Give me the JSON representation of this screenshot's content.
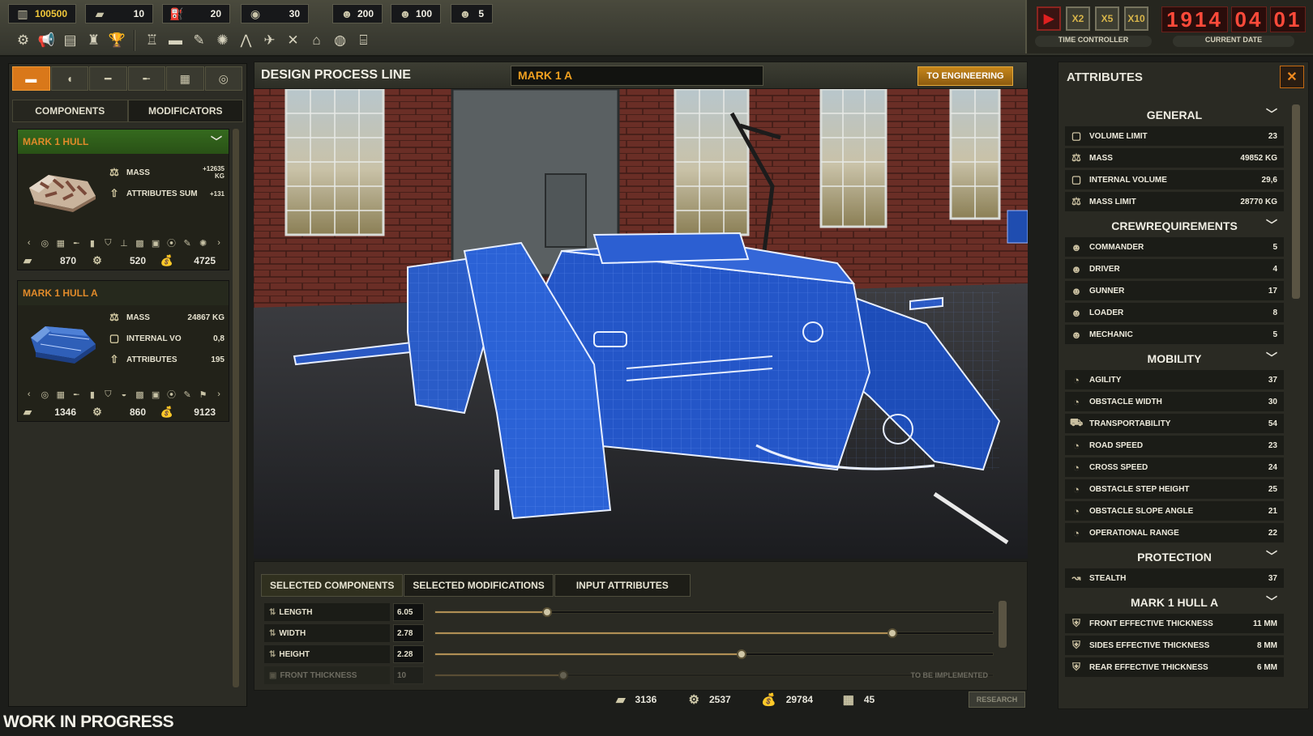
{
  "resources": [
    {
      "icon": "gold-icon",
      "value": "100500",
      "gold": true
    },
    {
      "icon": "steel-icon",
      "value": "10"
    },
    {
      "icon": "fuel-icon",
      "value": "20"
    },
    {
      "icon": "rubber-icon",
      "value": "30"
    },
    {
      "icon": "engineer-icon",
      "value": "200"
    },
    {
      "icon": "worker-icon",
      "value": "100"
    },
    {
      "icon": "officer-icon",
      "value": "5"
    }
  ],
  "time_controller": {
    "play": "▶",
    "x2": "X2",
    "x5": "X5",
    "x10": "X10",
    "caption": "TIME CONTROLLER"
  },
  "current_date": {
    "year": "1914",
    "month": "04",
    "day": "01",
    "caption": "CURRENT DATE"
  },
  "left_panel": {
    "subtabs": [
      "COMPONENTS",
      "MODIFICATORS"
    ],
    "components": [
      {
        "name": "MARK 1 HULL",
        "stats": [
          {
            "icon": "mass-icon",
            "label": "MASS",
            "value": "+12635 KG"
          },
          {
            "icon": "attributes-icon",
            "label": "ATTRIBUTES SUM",
            "value": "+131"
          }
        ],
        "costs": [
          {
            "icon": "steel-icon",
            "value": "870"
          },
          {
            "icon": "gear-icon",
            "value": "520"
          },
          {
            "icon": "money-bag-icon",
            "value": "4725"
          }
        ]
      },
      {
        "name": "MARK 1 HULL A",
        "stats": [
          {
            "icon": "mass-icon",
            "label": "MASS",
            "value": "24867 KG"
          },
          {
            "icon": "volume-icon",
            "label": "INTERNAL VO",
            "value": "0,8"
          },
          {
            "icon": "attributes-icon",
            "label": "ATTRIBUTES",
            "value": "195"
          }
        ],
        "costs": [
          {
            "icon": "steel-icon",
            "value": "1346"
          },
          {
            "icon": "gear-icon",
            "value": "860"
          },
          {
            "icon": "money-bag-icon",
            "value": "9123"
          }
        ]
      }
    ]
  },
  "center": {
    "title": "DESIGN PROCESS LINE",
    "design_name": "MARK 1 A",
    "to_engineering": "TO ENGINEERING",
    "bottom_tabs": [
      "SELECTED COMPONENTS",
      "SELECTED MODIFICATIONS",
      "INPUT ATTRIBUTES"
    ],
    "sliders": [
      {
        "label": "LENGTH",
        "value": "6.05",
        "fraction": 0.2
      },
      {
        "label": "WIDTH",
        "value": "2.78",
        "fraction": 0.82
      },
      {
        "label": "HEIGHT",
        "value": "2.28",
        "fraction": 0.55
      },
      {
        "label": "FRONT THICKNESS",
        "value": "10",
        "fraction": 0.23,
        "disabled": true,
        "note": "TO BE IMPLEMENTED"
      }
    ]
  },
  "totals": [
    {
      "icon": "steel-icon",
      "value": "3136"
    },
    {
      "icon": "gear-icon",
      "value": "2537"
    },
    {
      "icon": "money-bag-icon",
      "value": "29784"
    },
    {
      "icon": "calendar-icon",
      "value": "45"
    }
  ],
  "research_label": "RESEARCH",
  "footer_label": "WORK IN PROGRESS",
  "attributes": {
    "title": "ATTRIBUTES",
    "close": "✕",
    "groups": [
      {
        "title": "GENERAL",
        "rows": [
          {
            "icon": "volume-icon",
            "label": "VOLUME LIMIT",
            "value": "23"
          },
          {
            "icon": "mass-icon",
            "label": "MASS",
            "value": "49852 KG"
          },
          {
            "icon": "volume-icon",
            "label": "INTERNAL VOLUME",
            "value": "29,6"
          },
          {
            "icon": "mass-icon",
            "label": "MASS LIMIT",
            "value": "28770 KG"
          }
        ]
      },
      {
        "title": "CREWREQUIREMENTS",
        "rows": [
          {
            "icon": "crew-icon",
            "label": "COMMANDER",
            "value": "5"
          },
          {
            "icon": "crew-icon",
            "label": "DRIVER",
            "value": "4"
          },
          {
            "icon": "crew-icon",
            "label": "GUNNER",
            "value": "17"
          },
          {
            "icon": "crew-icon",
            "label": "LOADER",
            "value": "8"
          },
          {
            "icon": "crew-icon",
            "label": "MECHANIC",
            "value": "5"
          }
        ]
      },
      {
        "title": "MOBILITY",
        "rows": [
          {
            "icon": "gauge-icon",
            "label": "AGILITY",
            "value": "37"
          },
          {
            "icon": "gauge-icon",
            "label": "OBSTACLE WIDTH",
            "value": "30"
          },
          {
            "icon": "truck-icon",
            "label": "TRANSPORTABILITY",
            "value": "54"
          },
          {
            "icon": "gauge-icon",
            "label": "ROAD SPEED",
            "value": "23"
          },
          {
            "icon": "gauge-icon",
            "label": "CROSS SPEED",
            "value": "24"
          },
          {
            "icon": "gauge-icon",
            "label": "OBSTACLE STEP HEIGHT",
            "value": "25"
          },
          {
            "icon": "gauge-icon",
            "label": "OBSTACLE SLOPE ANGLE",
            "value": "21"
          },
          {
            "icon": "gauge-icon",
            "label": "OPERATIONAL RANGE",
            "value": "22"
          }
        ]
      },
      {
        "title": "PROTECTION",
        "rows": [
          {
            "icon": "stealth-icon",
            "label": "STEALTH",
            "value": "37"
          }
        ]
      },
      {
        "title": "MARK 1 HULL A",
        "rows": [
          {
            "icon": "armor-icon",
            "label": "FRONT EFFECTIVE THICKNESS",
            "value": "11 MM"
          },
          {
            "icon": "armor-icon",
            "label": "SIDES EFFECTIVE THICKNESS",
            "value": "8 MM"
          },
          {
            "icon": "armor-icon",
            "label": "REAR EFFECTIVE THICKNESS",
            "value": "6 MM"
          }
        ]
      }
    ]
  }
}
